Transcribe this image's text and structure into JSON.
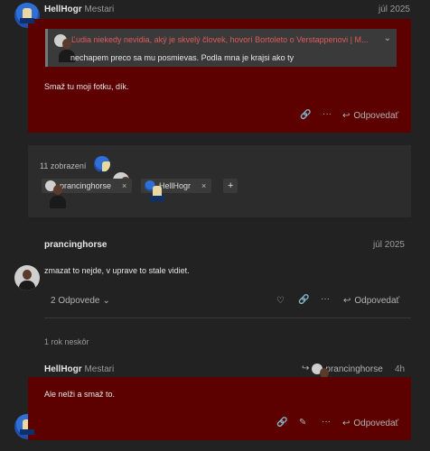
{
  "colors": {
    "page_bg": "#222222",
    "red_post": "#5c0000",
    "quote_title": "#e05a5a"
  },
  "post1": {
    "username": "HellHogr",
    "user_title": "Mestari",
    "date": "júl 2025",
    "quote": {
      "title": "Ľudia niekedy nevidia, aký je skvelý človek, hovorí Bortoleto o Verstappenovi | M...",
      "text": "nechapem preco sa mu posmievas. Podla mna je krajsi ako ty"
    },
    "body": "Smaž tu moji fotku, dík.",
    "reply_label": "Odpovedať"
  },
  "summary": {
    "views": "11 zobrazení",
    "chips": [
      {
        "label": "prancinghorse",
        "close": "×",
        "avatar_icon": "person-avatar"
      },
      {
        "label": "HellHogr",
        "close": "×",
        "avatar_icon": "blue-avatar"
      }
    ],
    "add": "+"
  },
  "post2": {
    "username": "prancinghorse",
    "date": "júl 2025",
    "body": "zmazat to nejde, v uprave to stale vidiet.",
    "replies_label": "2 Odpovede",
    "reply_label": "Odpovedať"
  },
  "gap": {
    "label": "1 rok neskôr"
  },
  "post3": {
    "username": "HellHogr",
    "user_title": "Mestari",
    "reply_to": "prancinghorse",
    "age": "4h",
    "body": "Ale nelži a smaž to.",
    "reply_label": "Odpovedať"
  },
  "icons": [
    "link-icon",
    "more-icon",
    "reply-icon",
    "heart-icon",
    "edit-icon",
    "chevron-down-icon",
    "add-icon"
  ]
}
